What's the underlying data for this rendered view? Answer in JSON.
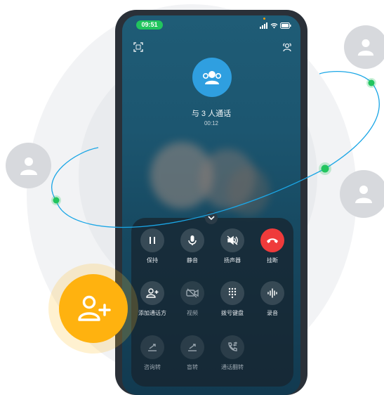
{
  "status_bar": {
    "time": "09:51"
  },
  "call": {
    "title": "与 3 人通话",
    "duration": "00:12"
  },
  "controls": {
    "row1": [
      {
        "label": "保持",
        "icon": "pause-icon"
      },
      {
        "label": "静音",
        "icon": "microphone-icon"
      },
      {
        "label": "扬声器",
        "icon": "speaker-muted-icon"
      },
      {
        "label": "挂断",
        "icon": "hang-up-icon"
      }
    ],
    "row2": [
      {
        "label": "添加通话方",
        "icon": "add-person-icon"
      },
      {
        "label": "视频",
        "icon": "video-off-icon"
      },
      {
        "label": "拨号键盘",
        "icon": "keypad-icon"
      },
      {
        "label": "录音",
        "icon": "recording-icon"
      }
    ],
    "row3": [
      {
        "label": "咨询转",
        "icon": "consult-transfer-icon"
      },
      {
        "label": "盲转",
        "icon": "blind-transfer-icon"
      },
      {
        "label": "通话翻转",
        "icon": "call-flip-icon"
      }
    ]
  },
  "colors": {
    "hang_up": "#ef3b3b",
    "accent_blue": "#2f9fe0",
    "status_green": "#22c55e",
    "add_badge": "#ffb20f",
    "orbit_line": "#1aa6e6",
    "orbit_node": "#22c55e"
  }
}
